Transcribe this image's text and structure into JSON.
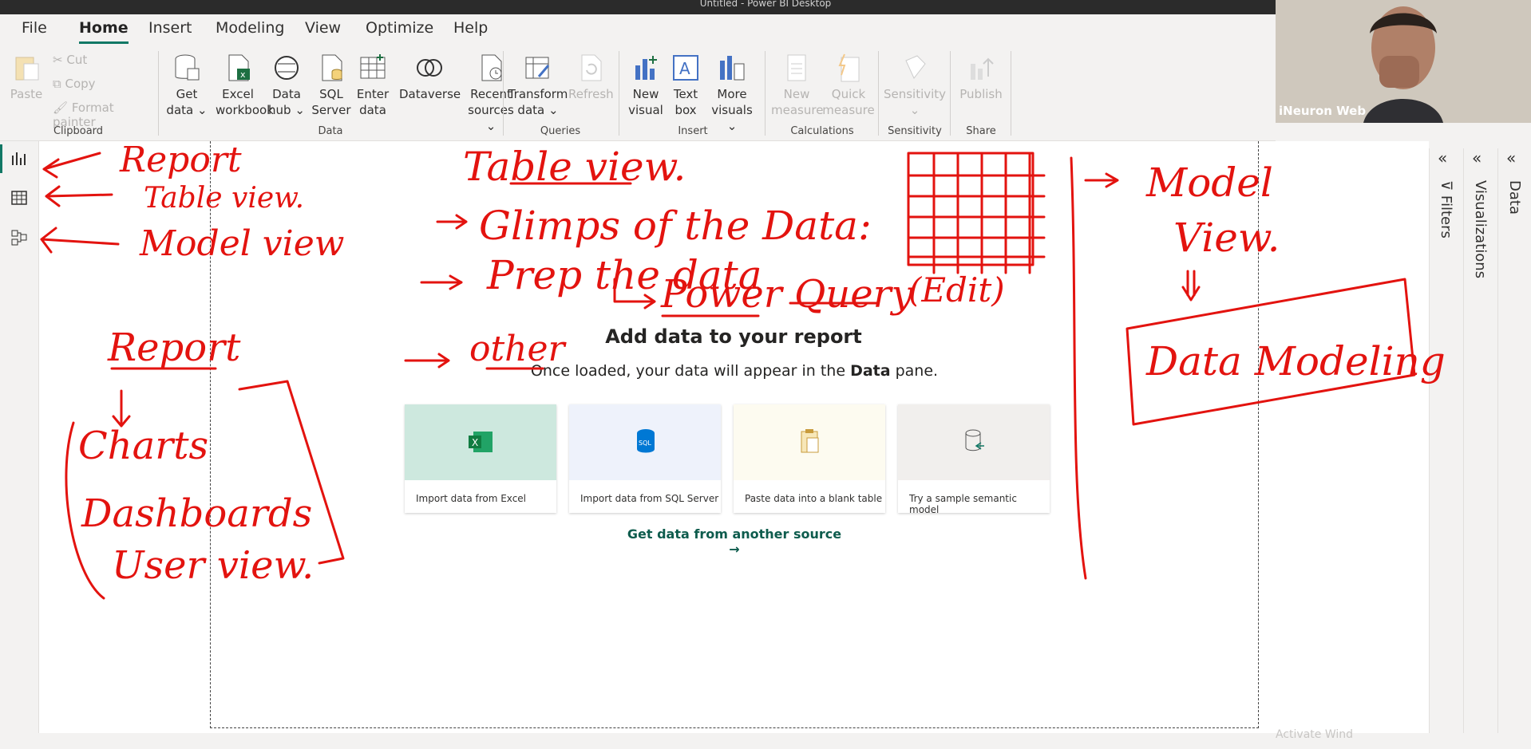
{
  "titlebar": {
    "title": "Untitled - Power BI Desktop"
  },
  "tabs": [
    "File",
    "Home",
    "Insert",
    "Modeling",
    "View",
    "Optimize",
    "Help"
  ],
  "ribbon": {
    "clipboard": {
      "paste": "Paste",
      "cut": "Cut",
      "copy": "Copy",
      "format_painter": "Format painter",
      "label": "Clipboard"
    },
    "data": {
      "get_data": [
        "Get",
        "data"
      ],
      "excel": [
        "Excel",
        "workbook"
      ],
      "data_hub": [
        "Data",
        "hub"
      ],
      "sql": [
        "SQL",
        "Server"
      ],
      "enter": [
        "Enter",
        "data"
      ],
      "dataverse": "Dataverse",
      "recent": [
        "Recent",
        "sources"
      ],
      "label": "Data"
    },
    "queries": {
      "transform": [
        "Transform",
        "data"
      ],
      "refresh": "Refresh",
      "label": "Queries"
    },
    "insert": {
      "new_visual": [
        "New",
        "visual"
      ],
      "text_box": [
        "Text",
        "box"
      ],
      "more": [
        "More",
        "visuals"
      ],
      "label": "Insert"
    },
    "calc": {
      "new_measure": [
        "New",
        "measure"
      ],
      "quick_measure": [
        "Quick",
        "measure"
      ],
      "label": "Calculations"
    },
    "sensitivity": {
      "btn": "Sensitivity",
      "label": "Sensitivity"
    },
    "share": {
      "publish": "Publish",
      "label": "Share"
    }
  },
  "canvas": {
    "title": "Add data to your report",
    "subtitle_pre": "Once loaded, your data will appear in the ",
    "subtitle_bold": "Data",
    "subtitle_post": " pane.",
    "cards": [
      "Import data from Excel",
      "Import data from SQL Server",
      "Paste data into a blank table",
      "Try a sample semantic model"
    ],
    "link": "Get data from another source →"
  },
  "panes": {
    "filters": "Filters",
    "visualizations": "Visualizations",
    "data": "Data"
  },
  "webcam": {
    "name": "iNeuron Web"
  },
  "watermark": "Activate Wind",
  "ink": {
    "report": "Report",
    "tableview": "Table view.",
    "modelview": "Model view",
    "table_view": "Table view.",
    "glimps": "Glimps of the Data:",
    "prep": "Prep the data",
    "power_query": "Power Query",
    "edit": "(Edit)",
    "other": "other",
    "report2": "Report",
    "charts": "Charts",
    "dashboards": "Dashboards",
    "user_view": "User view.",
    "model": "Model",
    "view": "View.",
    "data_modeling": "Data Modeling"
  },
  "colors": {
    "accent": "#117865",
    "ink": "#e3130f"
  }
}
